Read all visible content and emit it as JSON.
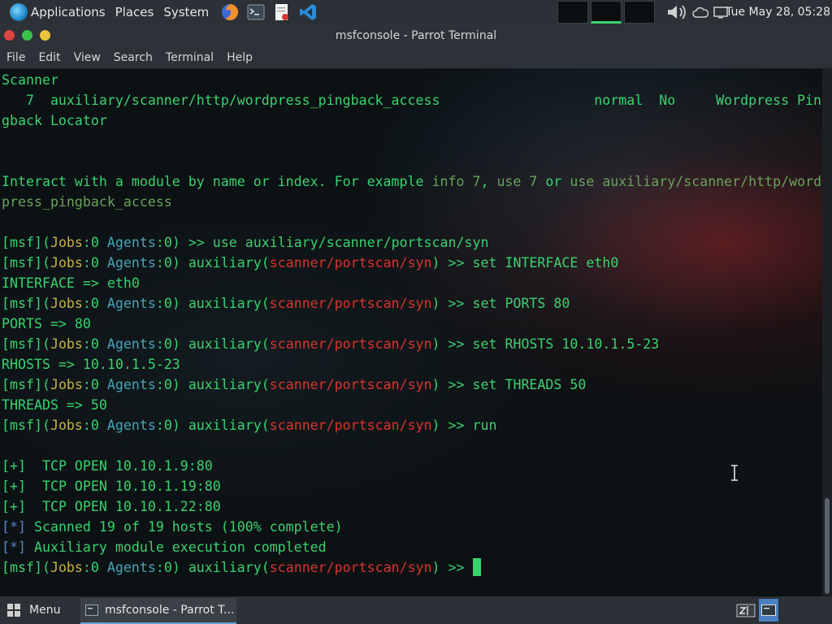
{
  "top_panel": {
    "applications": "Applications",
    "places": "Places",
    "system": "System",
    "clock": "Tue May 28, 05:28"
  },
  "window": {
    "title": "msfconsole - Parrot Terminal"
  },
  "menu": [
    "File",
    "Edit",
    "View",
    "Search",
    "Terminal",
    "Help"
  ],
  "terminal_lines": [
    [
      {
        "t": "Scanner",
        "c": "g"
      }
    ],
    [
      {
        "t": "   7  auxiliary/scanner/http/wordpress_pingback_access                   normal  No     Wordpress Pin",
        "c": "g"
      }
    ],
    [
      {
        "t": "gback Locator",
        "c": "g"
      }
    ],
    [],
    [],
    [
      {
        "t": "Interact with a module by name or index. For example ",
        "c": "g"
      },
      {
        "t": "info 7",
        "c": "dg"
      },
      {
        "t": ", ",
        "c": "g"
      },
      {
        "t": "use 7",
        "c": "dg"
      },
      {
        "t": " or ",
        "c": "g"
      },
      {
        "t": "use auxiliary/scanner/http/word",
        "c": "dg"
      }
    ],
    [
      {
        "t": "press_pingback_access",
        "c": "dg"
      }
    ],
    [],
    [
      {
        "t": "[msf]",
        "c": "g"
      },
      {
        "t": "(",
        "c": "g"
      },
      {
        "t": "Jobs",
        "c": "y"
      },
      {
        "t": ":0 ",
        "c": "g"
      },
      {
        "t": "Agents",
        "c": "c"
      },
      {
        "t": ":0) >> use auxiliary/scanner/portscan/syn",
        "c": "g"
      }
    ],
    [
      {
        "t": "[msf]",
        "c": "g"
      },
      {
        "t": "(",
        "c": "g"
      },
      {
        "t": "Jobs",
        "c": "y"
      },
      {
        "t": ":0 ",
        "c": "g"
      },
      {
        "t": "Agents",
        "c": "c"
      },
      {
        "t": ":0) auxiliary(",
        "c": "g"
      },
      {
        "t": "scanner/portscan/syn",
        "c": "r"
      },
      {
        "t": ") >> set INTERFACE eth0",
        "c": "g"
      }
    ],
    [
      {
        "t": "INTERFACE => eth0",
        "c": "g"
      }
    ],
    [
      {
        "t": "[msf]",
        "c": "g"
      },
      {
        "t": "(",
        "c": "g"
      },
      {
        "t": "Jobs",
        "c": "y"
      },
      {
        "t": ":0 ",
        "c": "g"
      },
      {
        "t": "Agents",
        "c": "c"
      },
      {
        "t": ":0) auxiliary(",
        "c": "g"
      },
      {
        "t": "scanner/portscan/syn",
        "c": "r"
      },
      {
        "t": ") >> set PORTS 80",
        "c": "g"
      }
    ],
    [
      {
        "t": "PORTS => 80",
        "c": "g"
      }
    ],
    [
      {
        "t": "[msf]",
        "c": "g"
      },
      {
        "t": "(",
        "c": "g"
      },
      {
        "t": "Jobs",
        "c": "y"
      },
      {
        "t": ":0 ",
        "c": "g"
      },
      {
        "t": "Agents",
        "c": "c"
      },
      {
        "t": ":0) auxiliary(",
        "c": "g"
      },
      {
        "t": "scanner/portscan/syn",
        "c": "r"
      },
      {
        "t": ") >> set RHOSTS 10.10.1.5-23",
        "c": "g"
      }
    ],
    [
      {
        "t": "RHOSTS => 10.10.1.5-23",
        "c": "g"
      }
    ],
    [
      {
        "t": "[msf]",
        "c": "g"
      },
      {
        "t": "(",
        "c": "g"
      },
      {
        "t": "Jobs",
        "c": "y"
      },
      {
        "t": ":0 ",
        "c": "g"
      },
      {
        "t": "Agents",
        "c": "c"
      },
      {
        "t": ":0) auxiliary(",
        "c": "g"
      },
      {
        "t": "scanner/portscan/syn",
        "c": "r"
      },
      {
        "t": ") >> set THREADS 50",
        "c": "g"
      }
    ],
    [
      {
        "t": "THREADS => 50",
        "c": "g"
      }
    ],
    [
      {
        "t": "[msf]",
        "c": "g"
      },
      {
        "t": "(",
        "c": "g"
      },
      {
        "t": "Jobs",
        "c": "y"
      },
      {
        "t": ":0 ",
        "c": "g"
      },
      {
        "t": "Agents",
        "c": "c"
      },
      {
        "t": ":0) auxiliary(",
        "c": "g"
      },
      {
        "t": "scanner/portscan/syn",
        "c": "r"
      },
      {
        "t": ") >> run",
        "c": "g"
      }
    ],
    [],
    [
      {
        "t": "[+]",
        "c": "g"
      },
      {
        "t": "  TCP OPEN 10.10.1.9:80",
        "c": "g"
      }
    ],
    [
      {
        "t": "[+]",
        "c": "g"
      },
      {
        "t": "  TCP OPEN 10.10.1.19:80",
        "c": "g"
      }
    ],
    [
      {
        "t": "[+]",
        "c": "g"
      },
      {
        "t": "  TCP OPEN 10.10.1.22:80",
        "c": "g"
      }
    ],
    [
      {
        "t": "[*]",
        "c": "b"
      },
      {
        "t": " Scanned 19 of 19 hosts (100% complete)",
        "c": "g"
      }
    ],
    [
      {
        "t": "[*]",
        "c": "b"
      },
      {
        "t": " Auxiliary module execution completed",
        "c": "g"
      }
    ],
    [
      {
        "t": "[msf]",
        "c": "g"
      },
      {
        "t": "(",
        "c": "g"
      },
      {
        "t": "Jobs",
        "c": "y"
      },
      {
        "t": ":0 ",
        "c": "g"
      },
      {
        "t": "Agents",
        "c": "c"
      },
      {
        "t": ":0) auxiliary(",
        "c": "g"
      },
      {
        "t": "scanner/portscan/syn",
        "c": "r"
      },
      {
        "t": ") >> ",
        "c": "g"
      },
      {
        "cursor": true
      }
    ]
  ],
  "bottom_panel": {
    "menu_label": "Menu",
    "task_label": "msfconsole - Parrot T..."
  },
  "colors": {
    "prompt_green": "#3ad26e",
    "module_red": "#d8352f",
    "jobs_yellow": "#c7b04a",
    "agents_cyan": "#4aa3b8",
    "info_blue": "#5b86c9"
  },
  "icons": [
    "parrot-logo-icon",
    "firefox-icon",
    "terminal-launcher-icon",
    "text-editor-icon",
    "vscode-icon",
    "volume-icon",
    "weather-icon",
    "display-icon",
    "menu-grid-icon",
    "terminal-icon"
  ]
}
